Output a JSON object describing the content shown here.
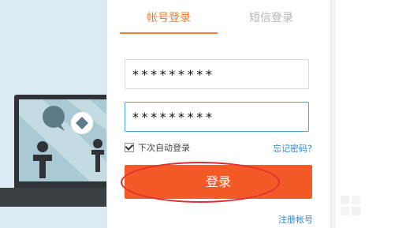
{
  "tabs": [
    {
      "label": "帐号登录",
      "active": true
    },
    {
      "label": "短信登录",
      "active": false
    }
  ],
  "inputs": {
    "account_value": "*********",
    "password_value": "*********"
  },
  "remember": {
    "label": "下次自动登录",
    "checked": true
  },
  "forgot_link": "忘记密码？",
  "login_button": "登录",
  "register_link": "注册帐号",
  "colors": {
    "accent_tab": "#f07b2a",
    "login_button": "#f45a28",
    "link": "#2e86d1",
    "highlight_ellipse": "#e03030",
    "focus_border": "#4fa3dc"
  },
  "icons": {
    "laptop_illustration": "laptop-illustration",
    "checkbox": "checkbox-checked"
  }
}
